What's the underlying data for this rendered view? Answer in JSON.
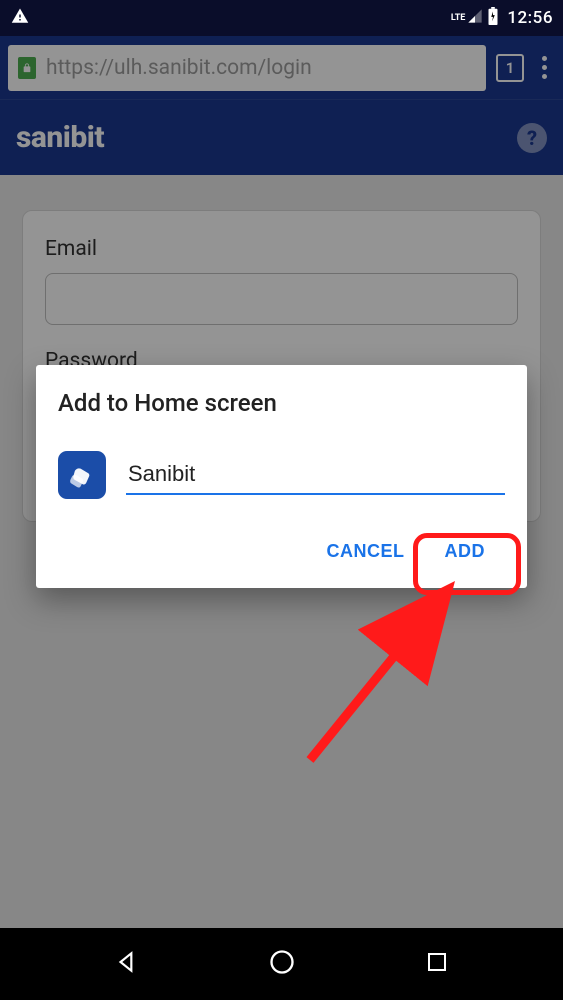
{
  "status": {
    "lte": "LTE",
    "time": "12:56"
  },
  "browser": {
    "url": "https://ulh.sanibit.com/login",
    "tab_count": "1"
  },
  "app": {
    "title": "sanibit"
  },
  "form": {
    "email_label": "Email",
    "password_label": "Password"
  },
  "dialog": {
    "title": "Add to Home screen",
    "name_value": "Sanibit",
    "cancel_label": "CANCEL",
    "add_label": "ADD"
  }
}
